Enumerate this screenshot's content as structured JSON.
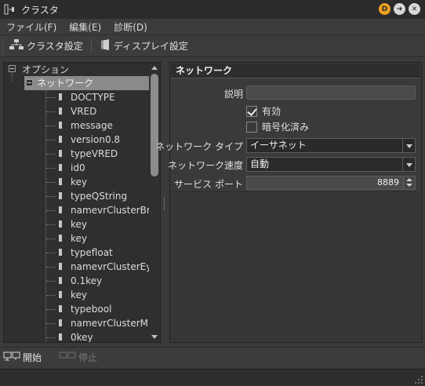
{
  "window": {
    "title": "クラスタ",
    "buttons": [
      {
        "name": "d-button",
        "label": "D"
      },
      {
        "name": "forward-button",
        "label": "➜"
      },
      {
        "name": "close-button",
        "label": "✕"
      }
    ]
  },
  "menu": [
    {
      "label": "ファイル(F)"
    },
    {
      "label": "編集(E)"
    },
    {
      "label": "診断(D)"
    }
  ],
  "toolbar": {
    "cluster_settings": "クラスタ設定",
    "display_settings": "ディスプレイ設定"
  },
  "tree": {
    "root": "オプション",
    "network": "ネットワーク",
    "children": [
      "DOCTYPE",
      "VRED",
      "message",
      "version0.8",
      "typeVRED",
      "id0",
      "key",
      "typeQString",
      "namevrClusterBr...",
      "key",
      "key",
      "typefloat",
      "namevrClusterEy...",
      "0.1key",
      "key",
      "typebool",
      "namevrClusterM...",
      "0key"
    ]
  },
  "panel": {
    "header": "ネットワーク",
    "description_label": "説明",
    "description_value": "",
    "enabled_label": "有効",
    "enabled_checked": true,
    "encryption_label": "暗号化済み",
    "encryption_checked": false,
    "network_type_label": "ネットワーク タイプ",
    "network_type_value": "イーサネット",
    "network_speed_label": "ネットワーク速度",
    "network_speed_value": "自動",
    "service_port_label": "サービス ポート",
    "service_port_value": "8889"
  },
  "bottom": {
    "start": "開始",
    "stop": "停止"
  }
}
